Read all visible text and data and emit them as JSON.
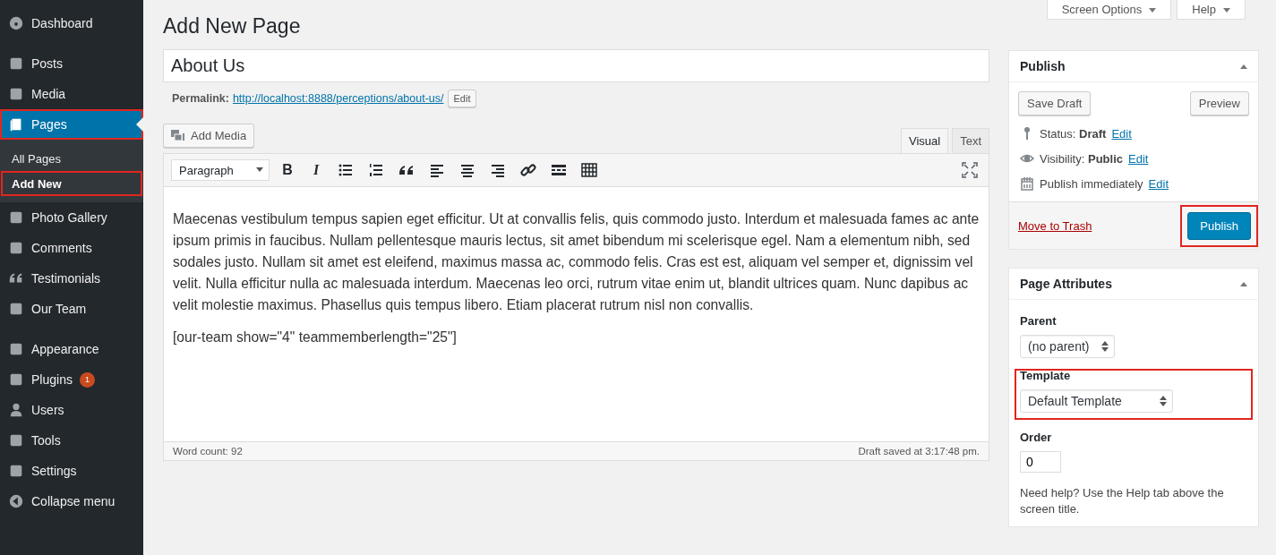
{
  "sidebar": {
    "groups": [
      [
        {
          "label": "Dashboard",
          "selected": false,
          "highlighted": false
        }
      ],
      [
        {
          "label": "Posts",
          "selected": false,
          "highlighted": false
        },
        {
          "label": "Media",
          "selected": false,
          "highlighted": false
        },
        {
          "label": "Pages",
          "selected": true,
          "highlighted": true,
          "children": [
            {
              "label": "All Pages",
              "selected": false,
              "highlighted": false
            },
            {
              "label": "Add New",
              "selected": true,
              "highlighted": true
            }
          ]
        },
        {
          "label": "Photo Gallery",
          "selected": false,
          "highlighted": false
        },
        {
          "label": "Comments",
          "selected": false,
          "highlighted": false
        },
        {
          "label": "Testimonials",
          "selected": false,
          "highlighted": false
        },
        {
          "label": "Our Team",
          "selected": false,
          "highlighted": false
        }
      ],
      [
        {
          "label": "Appearance",
          "selected": false,
          "highlighted": false
        },
        {
          "label": "Plugins",
          "selected": false,
          "highlighted": false,
          "badge": "1"
        },
        {
          "label": "Users",
          "selected": false,
          "highlighted": false
        },
        {
          "label": "Tools",
          "selected": false,
          "highlighted": false
        },
        {
          "label": "Settings",
          "selected": false,
          "highlighted": false
        },
        {
          "label": "Collapse menu",
          "selected": false,
          "highlighted": false
        }
      ]
    ]
  },
  "top_buttons": [
    "Screen Options",
    "Help"
  ],
  "page_title": "Add New Page",
  "title_field": {
    "value": "About Us"
  },
  "permalink": {
    "label": "Permalink:",
    "url": "http://localhost:8888/perceptions/about-us/",
    "edit": "Edit"
  },
  "add_media": "Add Media",
  "editor_tabs": [
    {
      "label": "Visual",
      "selected": true
    },
    {
      "label": "Text",
      "selected": false
    }
  ],
  "format_select": "Paragraph",
  "format_buttons": [
    "B",
    "I"
  ],
  "content": [
    "Maecenas vestibulum tempus sapien eget efficitur. Ut at convallis felis, quis commodo justo. Interdum et malesuada fames ac ante ipsum primis in faucibus. Nullam pellentesque mauris lectus, sit amet bibendum mi scelerisque egel. Nam a elementum nibh, sed sodales justo. Nullam sit amet est eleifend, maximus massa ac, commodo felis. Cras est est, aliquam vel semper et, dignissim vel velit. Nulla efficitur nulla ac malesuada interdum. Maecenas leo orci, rutrum vitae enim ut, blandit ultrices quam. Nunc dapibus ac velit molestie maximus. Phasellus quis tempus libero. Etiam placerat rutrum nisl non convallis.",
    "[our-team show=\"4\" teammemberlength=\"25\"]"
  ],
  "status_bar": {
    "word_count": "Word count: 92",
    "saved": "Draft saved at 3:17:48 pm."
  },
  "publish_box": {
    "title": "Publish",
    "save_draft": "Save Draft",
    "preview": "Preview",
    "rows": [
      {
        "label": "Status:",
        "value": "Draft",
        "edit": "Edit"
      },
      {
        "label": "Visibility:",
        "value": "Public",
        "edit": "Edit"
      },
      {
        "label": "Publish immediately",
        "value": "",
        "edit": "Edit"
      }
    ],
    "trash": "Move to Trash",
    "publish": "Publish",
    "publish_highlighted": true
  },
  "attributes_box": {
    "title": "Page Attributes",
    "parent_label": "Parent",
    "parent_value": "(no parent)",
    "template_label": "Template",
    "template_value": "Default Template",
    "template_highlighted": true,
    "order_label": "Order",
    "order_value": "0",
    "help": "Need help? Use the Help tab above the screen title."
  }
}
